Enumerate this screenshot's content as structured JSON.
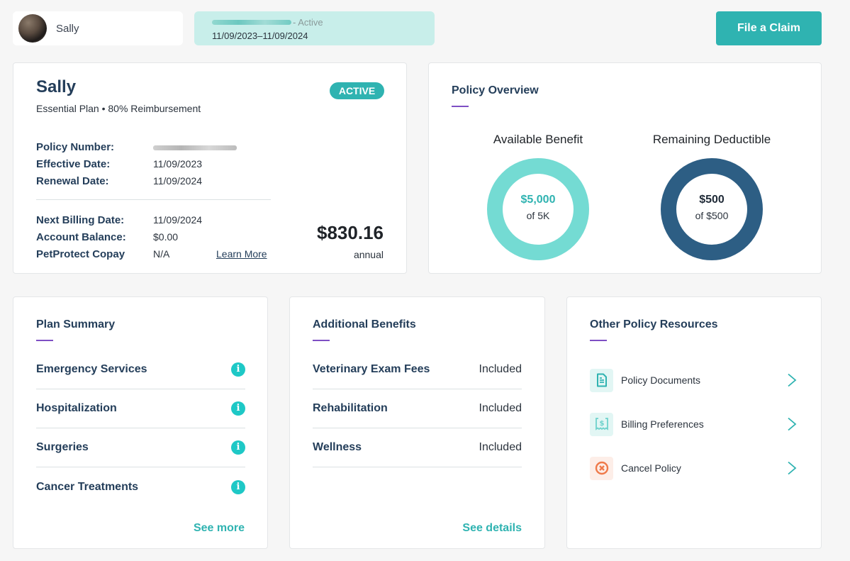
{
  "header": {
    "pet_name": "Sally",
    "policy_status_suffix": "- Active",
    "policy_period": "11/09/2023–11/09/2024",
    "file_claim_label": "File a Claim"
  },
  "pet_card": {
    "name": "Sally",
    "plan_line": "Essential Plan • 80% Reimbursement",
    "status_badge": "ACTIVE",
    "details": [
      {
        "label": "Policy Number:",
        "value": ""
      },
      {
        "label": "Effective Date:",
        "value": "11/09/2023"
      },
      {
        "label": "Renewal Date:",
        "value": "11/09/2024"
      }
    ],
    "billing": [
      {
        "label": "Next Billing Date:",
        "value": "11/09/2024"
      },
      {
        "label": "Account Balance:",
        "value": "$0.00"
      },
      {
        "label": "PetProtect Copay",
        "value": "N/A"
      }
    ],
    "learn_more_label": "Learn More",
    "price": "$830.16",
    "price_period": "annual"
  },
  "overview": {
    "title": "Policy Overview",
    "gauges": [
      {
        "label": "Available Benefit",
        "amount": "$5,000",
        "of_text": "of 5K",
        "fraction": 1.0,
        "color": "#74dbd3",
        "amount_color": "#2fb3b1"
      },
      {
        "label": "Remaining Deductible",
        "amount": "$500",
        "of_text": "of $500",
        "fraction": 1.0,
        "color": "#2d5e84",
        "amount_color": "#1f2a37"
      }
    ]
  },
  "plan_summary": {
    "title": "Plan Summary",
    "items": [
      "Emergency Services",
      "Hospitalization",
      "Surgeries",
      "Cancer Treatments"
    ],
    "footer_link": "See more"
  },
  "additional_benefits": {
    "title": "Additional Benefits",
    "items": [
      {
        "label": "Veterinary Exam Fees",
        "value": "Included"
      },
      {
        "label": "Rehabilitation",
        "value": "Included"
      },
      {
        "label": "Wellness",
        "value": "Included"
      }
    ],
    "footer_link": "See details"
  },
  "resources": {
    "title": "Other Policy Resources",
    "items": [
      {
        "label": "Policy Documents",
        "icon": "document-icon",
        "tint": "#e2f6f4",
        "color": "#2fb3b1"
      },
      {
        "label": "Billing Preferences",
        "icon": "receipt-dollar-icon",
        "tint": "#e2f6f4",
        "color": "#6fd2cc"
      },
      {
        "label": "Cancel Policy",
        "icon": "cancel-circle-icon",
        "tint": "#fdeee8",
        "color": "#ef7a4a"
      }
    ]
  },
  "colors": {
    "accent_teal": "#2fb3b1",
    "heading_navy": "#243e5a",
    "underline_purple": "#7e4fc4"
  }
}
